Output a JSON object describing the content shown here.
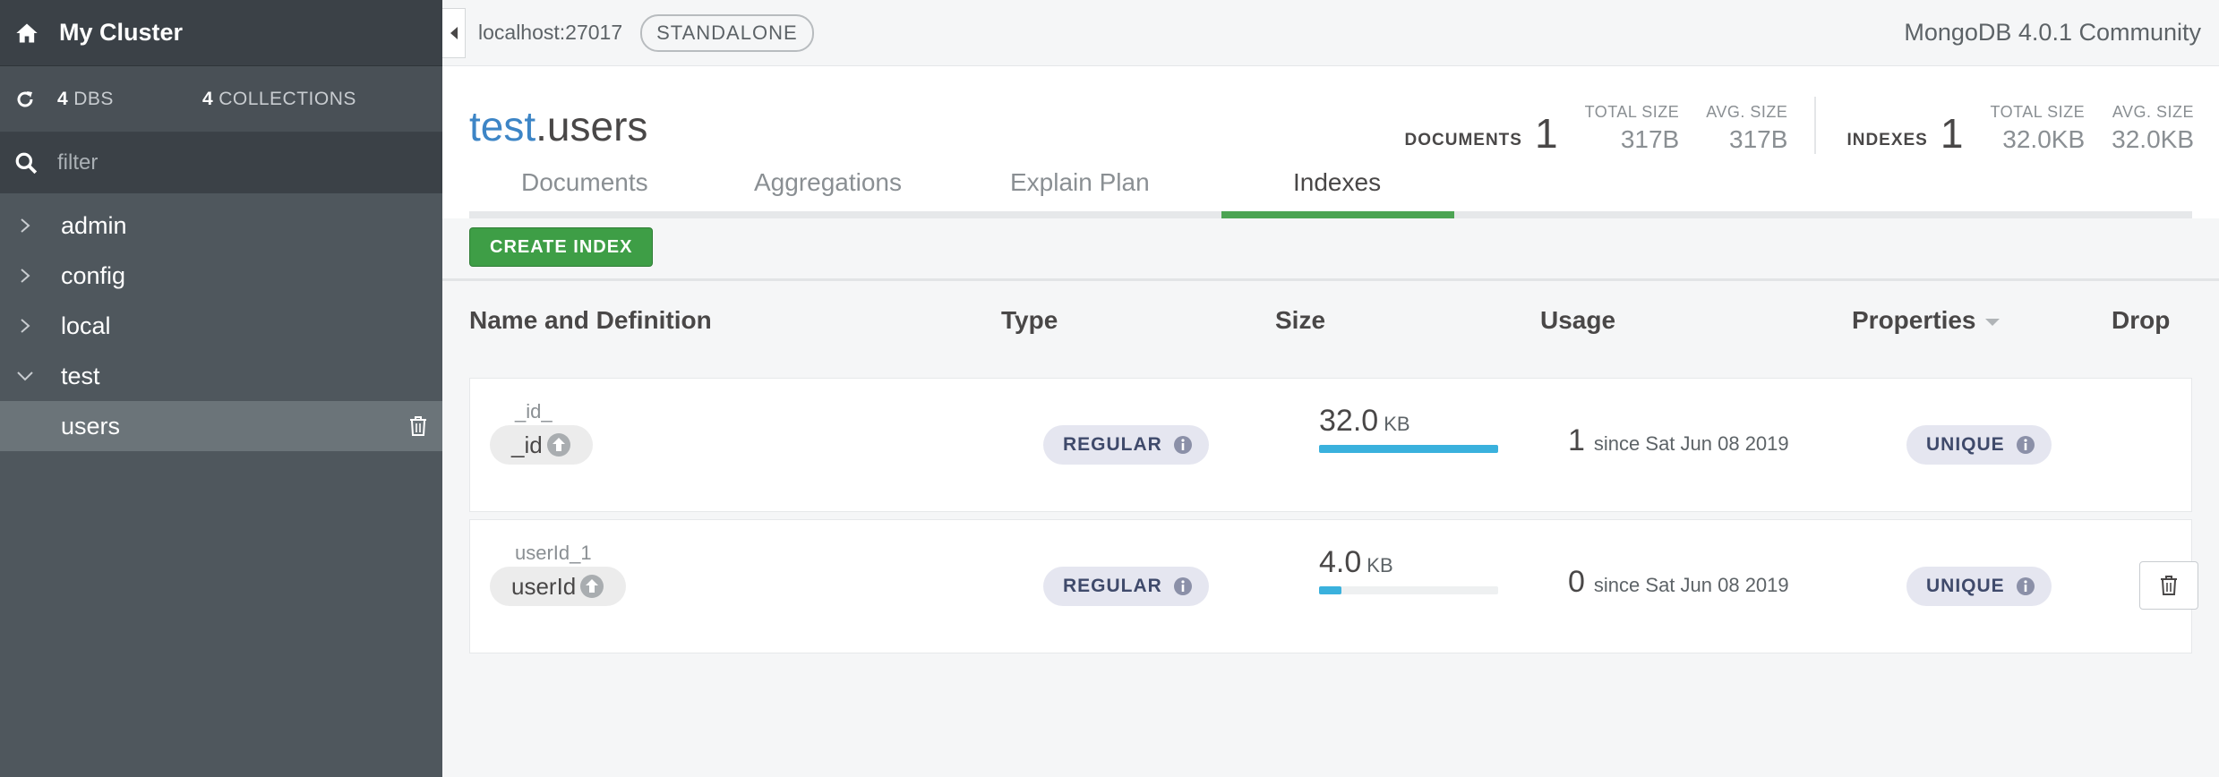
{
  "sidebar": {
    "title": "My Cluster",
    "dbs_count": "4",
    "dbs_label": "DBS",
    "collections_count": "4",
    "collections_label": "COLLECTIONS",
    "filter_placeholder": "filter",
    "databases": [
      {
        "name": "admin",
        "expanded": false
      },
      {
        "name": "config",
        "expanded": false
      },
      {
        "name": "local",
        "expanded": false
      },
      {
        "name": "test",
        "expanded": true
      }
    ],
    "selected_collection": "users"
  },
  "topbar": {
    "host": "localhost:27017",
    "topology": "STANDALONE",
    "version": "MongoDB 4.0.1 Community"
  },
  "collection": {
    "db": "test",
    "name": ".users",
    "documents_label": "DOCUMENTS",
    "documents_count": "1",
    "doc_total_size_label": "TOTAL SIZE",
    "doc_total_size": "317B",
    "doc_avg_size_label": "AVG. SIZE",
    "doc_avg_size": "317B",
    "indexes_label": "INDEXES",
    "indexes_count": "1",
    "idx_total_size_label": "TOTAL SIZE",
    "idx_total_size": "32.0KB",
    "idx_avg_size_label": "AVG. SIZE",
    "idx_avg_size": "32.0KB"
  },
  "tabs": [
    "Documents",
    "Aggregations",
    "Explain Plan",
    "Indexes"
  ],
  "active_tab": "Indexes",
  "toolbar": {
    "create_label": "CREATE INDEX"
  },
  "table": {
    "headers": {
      "name": "Name and Definition",
      "type": "Type",
      "size": "Size",
      "usage": "Usage",
      "properties": "Properties",
      "drop": "Drop"
    },
    "rows": [
      {
        "name": "_id_",
        "field": "_id",
        "type": "REGULAR",
        "size": "32.0",
        "size_unit": "KB",
        "size_fraction": 1.0,
        "usage_count": "1",
        "usage_since": "since Sat Jun 08 2019",
        "property": "UNIQUE",
        "droppable": false
      },
      {
        "name": "userId_1",
        "field": "userId",
        "type": "REGULAR",
        "size": "4.0",
        "size_unit": "KB",
        "size_fraction": 0.125,
        "usage_count": "0",
        "usage_since": "since Sat Jun 08 2019",
        "property": "UNIQUE",
        "droppable": true
      }
    ]
  },
  "colors": {
    "accent_green": "#4ca453",
    "db_blue": "#3d85c6",
    "size_bar": "#3ab1dd"
  }
}
